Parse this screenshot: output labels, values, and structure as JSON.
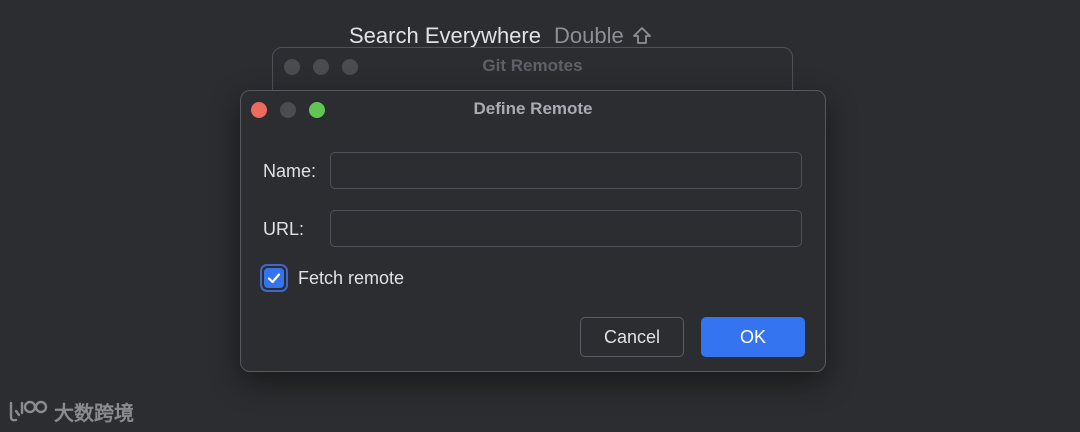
{
  "search_hint": {
    "label": "Search Everywhere",
    "shortcut": "Double",
    "shortcut_icon": "shift-key-icon"
  },
  "background_window": {
    "title": "Git Remotes"
  },
  "dialog": {
    "title": "Define Remote",
    "name_label": "Name:",
    "name_value": "",
    "url_label": "URL:",
    "url_value": "",
    "fetch_label": "Fetch remote",
    "fetch_checked": true,
    "cancel_label": "Cancel",
    "ok_label": "OK"
  },
  "watermark": {
    "text": "大数跨境"
  },
  "colors": {
    "background": "#2b2d30",
    "accent": "#3574f0",
    "traffic_red": "#ec6a5e",
    "traffic_yellow_inactive": "#4a4c50",
    "traffic_green": "#61c554"
  }
}
